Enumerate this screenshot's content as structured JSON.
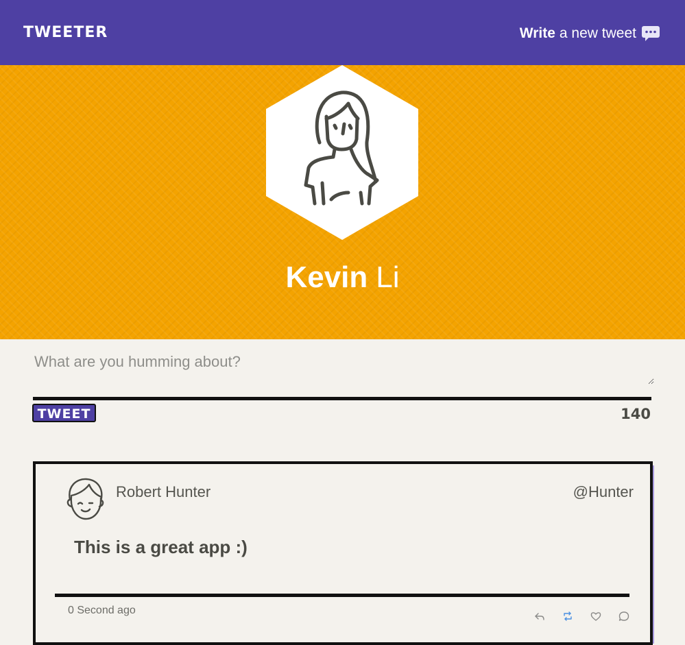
{
  "nav": {
    "brand": "TWEETER",
    "compose_bold": "Write",
    "compose_light": "a new tweet",
    "compose_icon": "speech-bubble-icon",
    "background_color": "#4e40a3"
  },
  "profile": {
    "first_name": "Kevin",
    "last_name": "Li",
    "avatar_icon": "woman-avatar-icon",
    "banner_color": "#f4a300"
  },
  "composer": {
    "placeholder": "What are you humming about?",
    "value": "",
    "submit_label": "TWEET",
    "char_count": "140"
  },
  "tweets": [
    {
      "author": "Robert Hunter",
      "handle": "@Hunter",
      "text": "This is a great app :)",
      "time": "0 Second ago",
      "avatar_icon": "man-avatar-icon",
      "actions": [
        "reply-icon",
        "retweet-icon",
        "like-icon",
        "comment-icon"
      ]
    }
  ]
}
